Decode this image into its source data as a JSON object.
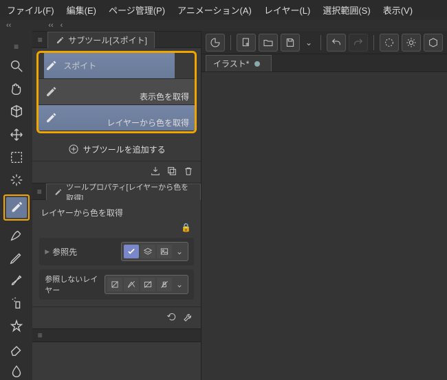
{
  "menu": {
    "file": "ファイル(F)",
    "edit": "編集(E)",
    "page": "ページ管理(P)",
    "anim": "アニメーション(A)",
    "layer": "レイヤー(L)",
    "select": "選択範囲(S)",
    "view": "表示(V)"
  },
  "subtool_panel": {
    "title": "サブツール[スポイト]"
  },
  "subtools": [
    {
      "label": "スポイト"
    },
    {
      "label": "表示色を取得"
    },
    {
      "label": "レイヤーから色を取得"
    }
  ],
  "add_label": "サブツールを追加する",
  "toolprop": {
    "title": "ツールプロパティ[レイヤーから色を取得]",
    "heading": "レイヤーから色を取得",
    "ref_target": "参照先",
    "ignore_layer": "参照しないレイヤー"
  },
  "doc_tab": "イラスト*"
}
